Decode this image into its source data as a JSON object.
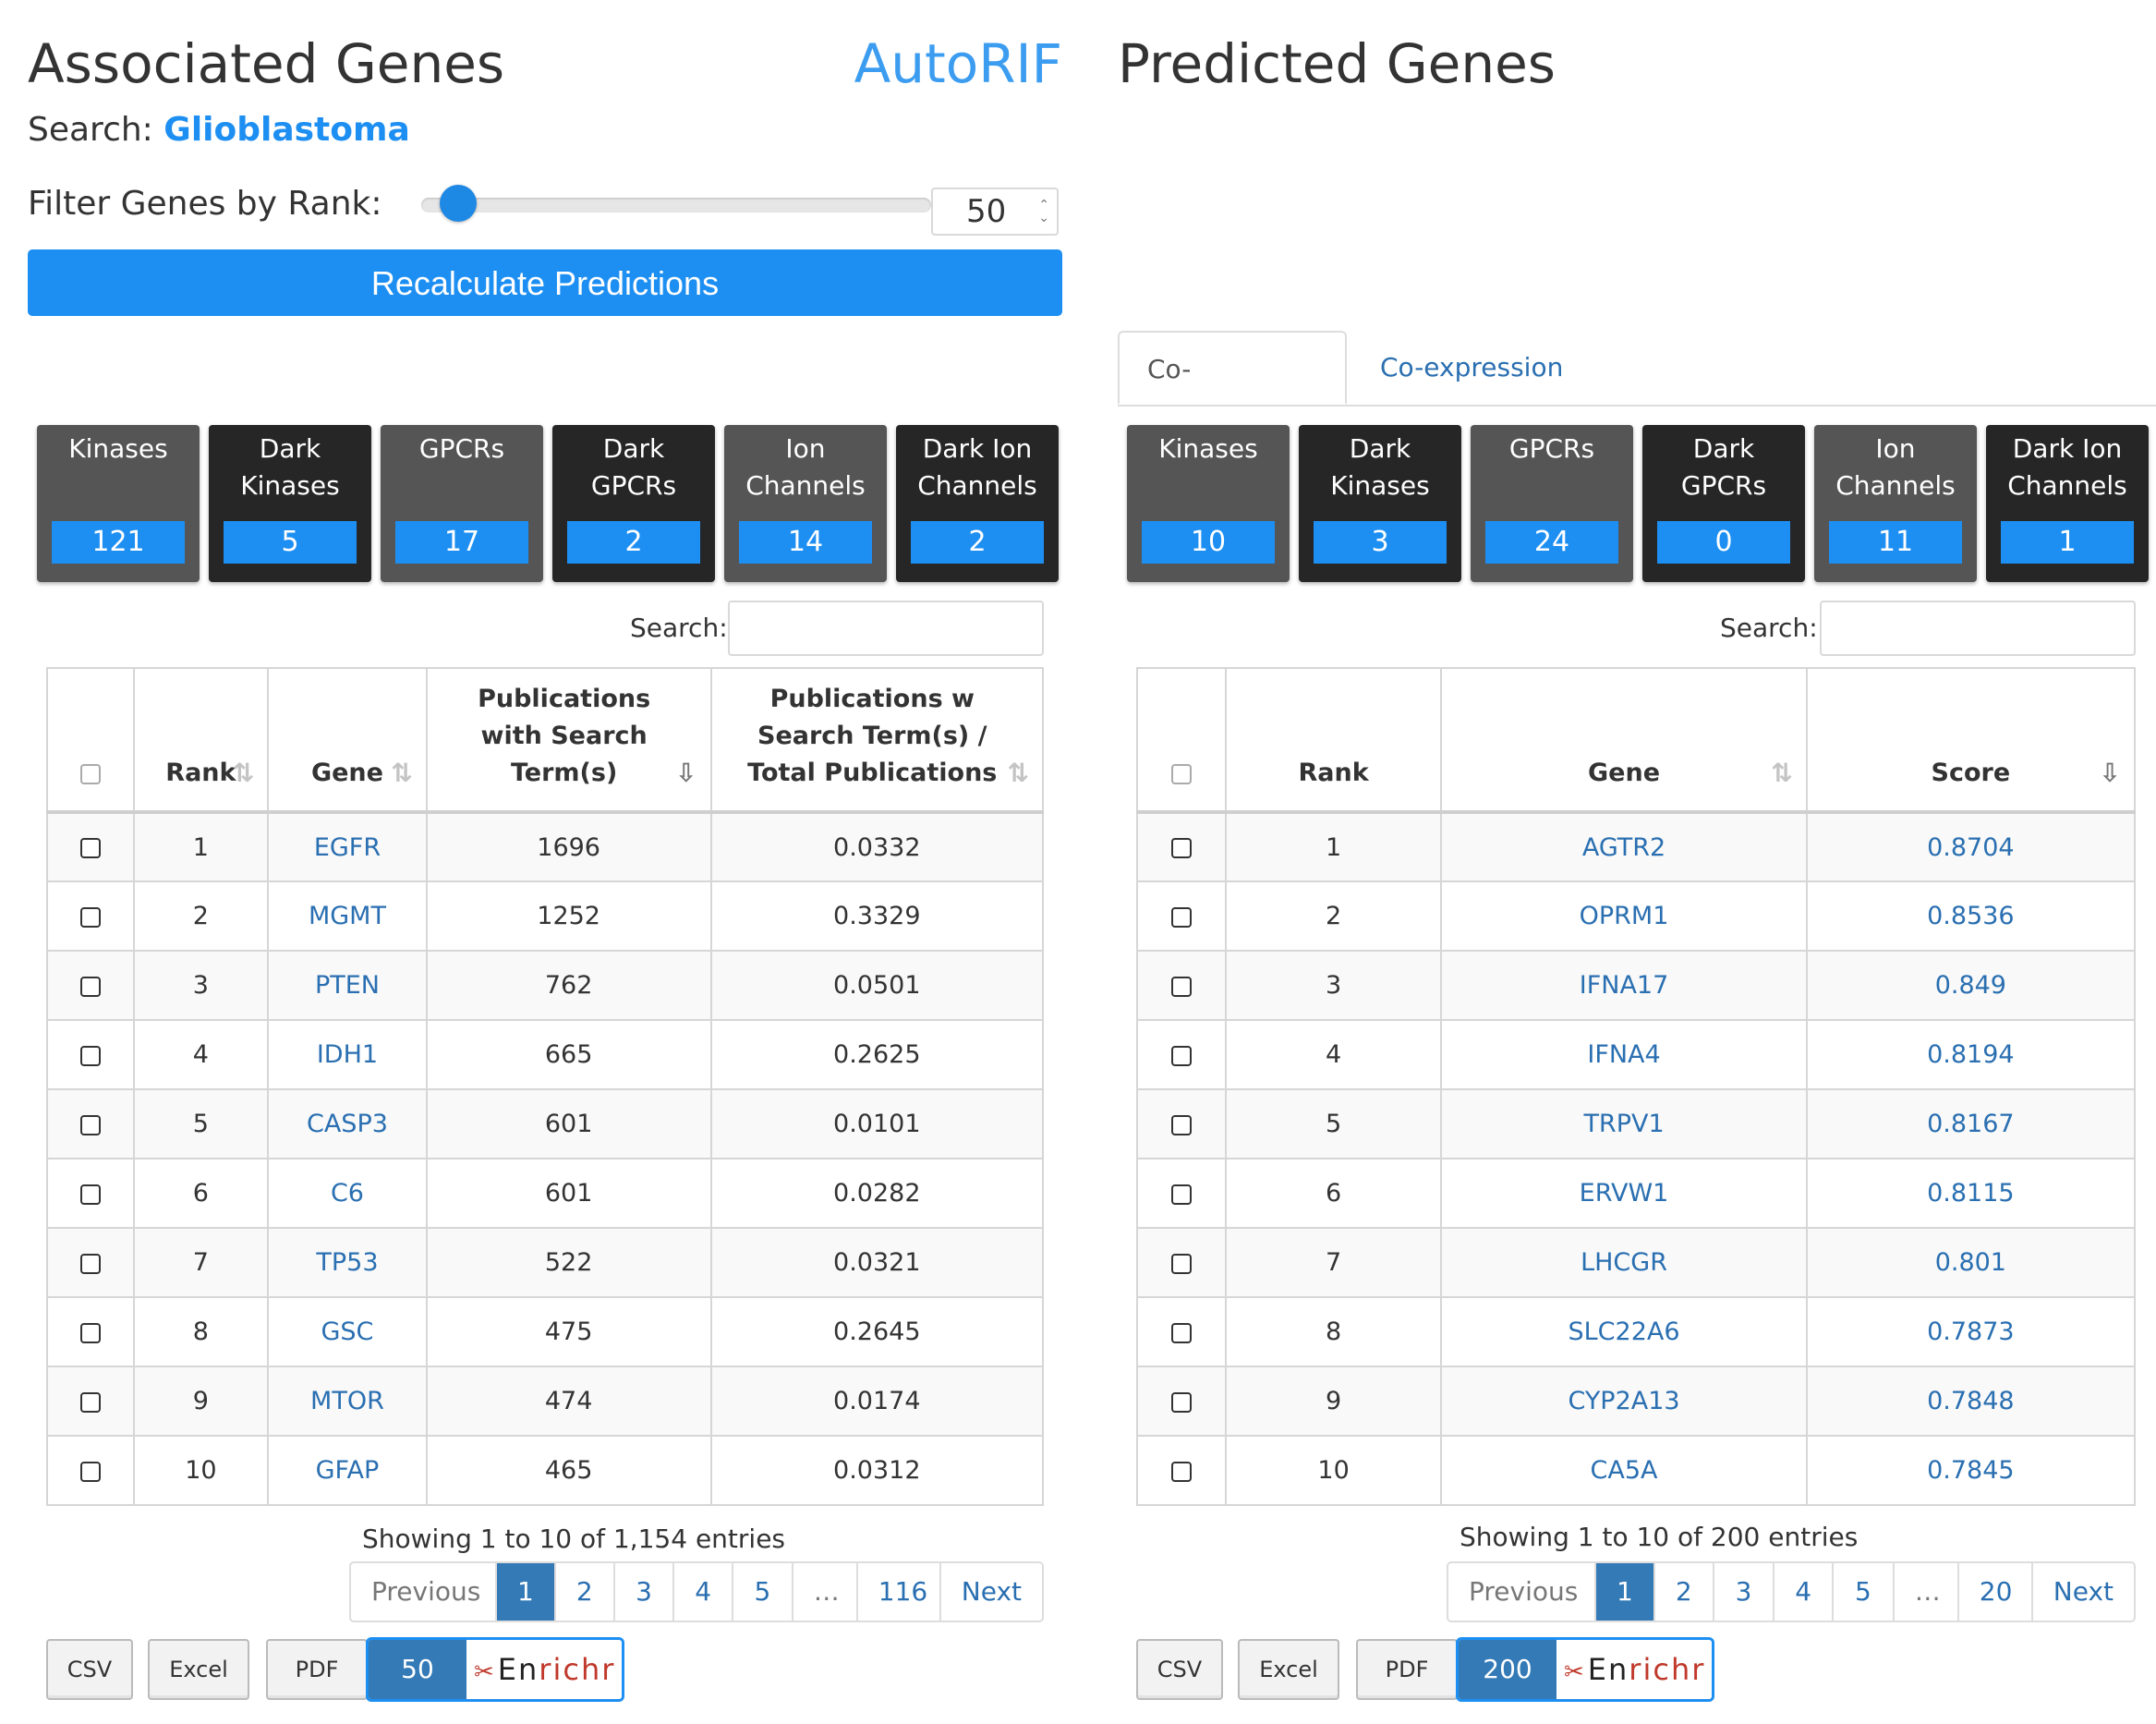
{
  "left": {
    "title": "Associated Genes",
    "autorif": "AutoRIF",
    "search_label": "Search:",
    "search_term": "Glioblastoma",
    "filter_label": "Filter Genes by Rank:",
    "rank_value": "50",
    "slider_level_fraction": 0.04,
    "recalc_label": "Recalculate Predictions",
    "categories": [
      {
        "label": "Kinases",
        "count": "121",
        "style": "light"
      },
      {
        "label": "Dark\nKinases",
        "count": "5",
        "style": "dark"
      },
      {
        "label": "GPCRs",
        "count": "17",
        "style": "light"
      },
      {
        "label": "Dark\nGPCRs",
        "count": "2",
        "style": "dark"
      },
      {
        "label": "Ion\nChannels",
        "count": "14",
        "style": "light"
      },
      {
        "label": "Dark Ion\nChannels",
        "count": "2",
        "style": "dark"
      }
    ],
    "table_search_label": "Search:",
    "columns": [
      "Rank",
      "Gene",
      "Publications with Search Term(s)",
      "Publications w Search Term(s) / Total Publications"
    ],
    "rows": [
      {
        "rank": "1",
        "gene": "EGFR",
        "pubs": "1696",
        "ratio": "0.0332"
      },
      {
        "rank": "2",
        "gene": "MGMT",
        "pubs": "1252",
        "ratio": "0.3329"
      },
      {
        "rank": "3",
        "gene": "PTEN",
        "pubs": "762",
        "ratio": "0.0501"
      },
      {
        "rank": "4",
        "gene": "IDH1",
        "pubs": "665",
        "ratio": "0.2625"
      },
      {
        "rank": "5",
        "gene": "CASP3",
        "pubs": "601",
        "ratio": "0.0101"
      },
      {
        "rank": "6",
        "gene": "C6",
        "pubs": "601",
        "ratio": "0.0282"
      },
      {
        "rank": "7",
        "gene": "TP53",
        "pubs": "522",
        "ratio": "0.0321"
      },
      {
        "rank": "8",
        "gene": "GSC",
        "pubs": "475",
        "ratio": "0.2645"
      },
      {
        "rank": "9",
        "gene": "MTOR",
        "pubs": "474",
        "ratio": "0.0174"
      },
      {
        "rank": "10",
        "gene": "GFAP",
        "pubs": "465",
        "ratio": "0.0312"
      }
    ],
    "showing": "Showing 1 to 10 of 1,154 entries",
    "pager": [
      "Previous",
      "1",
      "2",
      "3",
      "4",
      "5",
      "…",
      "116",
      "Next"
    ],
    "export": {
      "csv": "CSV",
      "excel": "Excel",
      "pdf": "PDF"
    },
    "enrichr_count": "50",
    "enrichr_label_a": "En",
    "enrichr_label_b": "richr"
  },
  "right": {
    "title": "Predicted Genes",
    "tabs": [
      "Co-occurrence",
      "Co-expression"
    ],
    "categories": [
      {
        "label": "Kinases",
        "count": "10",
        "style": "light"
      },
      {
        "label": "Dark\nKinases",
        "count": "3",
        "style": "dark"
      },
      {
        "label": "GPCRs",
        "count": "24",
        "style": "light"
      },
      {
        "label": "Dark\nGPCRs",
        "count": "0",
        "style": "dark"
      },
      {
        "label": "Ion\nChannels",
        "count": "11",
        "style": "light"
      },
      {
        "label": "Dark Ion\nChannels",
        "count": "1",
        "style": "dark"
      }
    ],
    "table_search_label": "Search:",
    "columns": [
      "Rank",
      "Gene",
      "Score"
    ],
    "rows": [
      {
        "rank": "1",
        "gene": "AGTR2",
        "score": "0.8704"
      },
      {
        "rank": "2",
        "gene": "OPRM1",
        "score": "0.8536"
      },
      {
        "rank": "3",
        "gene": "IFNA17",
        "score": "0.849"
      },
      {
        "rank": "4",
        "gene": "IFNA4",
        "score": "0.8194"
      },
      {
        "rank": "5",
        "gene": "TRPV1",
        "score": "0.8167"
      },
      {
        "rank": "6",
        "gene": "ERVW1",
        "score": "0.8115"
      },
      {
        "rank": "7",
        "gene": "LHCGR",
        "score": "0.801"
      },
      {
        "rank": "8",
        "gene": "SLC22A6",
        "score": "0.7873"
      },
      {
        "rank": "9",
        "gene": "CYP2A13",
        "score": "0.7848"
      },
      {
        "rank": "10",
        "gene": "CA5A",
        "score": "0.7845"
      }
    ],
    "showing": "Showing 1 to 10 of 200 entries",
    "pager": [
      "Previous",
      "1",
      "2",
      "3",
      "4",
      "5",
      "…",
      "20",
      "Next"
    ],
    "export": {
      "csv": "CSV",
      "excel": "Excel",
      "pdf": "PDF"
    },
    "enrichr_count": "200",
    "enrichr_label_a": "En",
    "enrichr_label_b": "richr"
  },
  "colors": {
    "accent": "#1e8ff2",
    "pager_active": "#337ab7",
    "link": "#2a6fb1",
    "tile_light": "#555555",
    "tile_dark": "#262626"
  },
  "icons": {
    "sort": "sort-icon",
    "dna": "dna-icon"
  }
}
